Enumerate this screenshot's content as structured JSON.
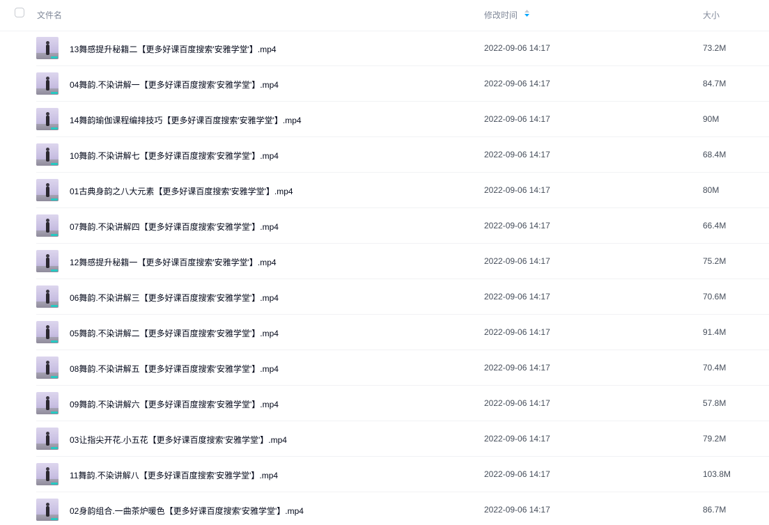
{
  "header": {
    "name_label": "文件名",
    "time_label": "修改时间",
    "size_label": "大小",
    "sort_icon": "sort-arrows-icon"
  },
  "colors": {
    "accent": "#06a7ff",
    "divider": "#f1f2f4",
    "thumb_badge": "#27c9c2"
  },
  "files": [
    {
      "name": "13舞感提升秘籍二【更多好课百度搜索'安雅学堂'】.mp4",
      "time": "2022-09-06 14:17",
      "size": "73.2M"
    },
    {
      "name": "04舞韵.不染讲解一【更多好课百度搜索'安雅学堂'】.mp4",
      "time": "2022-09-06 14:17",
      "size": "84.7M"
    },
    {
      "name": "14舞韵瑜伽课程编排技巧【更多好课百度搜索'安雅学堂'】.mp4",
      "time": "2022-09-06 14:17",
      "size": "90M"
    },
    {
      "name": "10舞韵.不染讲解七【更多好课百度搜索'安雅学堂'】.mp4",
      "time": "2022-09-06 14:17",
      "size": "68.4M"
    },
    {
      "name": "01古典身韵之八大元素【更多好课百度搜索'安雅学堂'】.mp4",
      "time": "2022-09-06 14:17",
      "size": "80M"
    },
    {
      "name": "07舞韵.不染讲解四【更多好课百度搜索'安雅学堂'】.mp4",
      "time": "2022-09-06 14:17",
      "size": "66.4M"
    },
    {
      "name": "12舞感提升秘籍一【更多好课百度搜索'安雅学堂'】.mp4",
      "time": "2022-09-06 14:17",
      "size": "75.2M"
    },
    {
      "name": "06舞韵.不染讲解三【更多好课百度搜索'安雅学堂'】.mp4",
      "time": "2022-09-06 14:17",
      "size": "70.6M"
    },
    {
      "name": "05舞韵.不染讲解二【更多好课百度搜索'安雅学堂'】.mp4",
      "time": "2022-09-06 14:17",
      "size": "91.4M"
    },
    {
      "name": "08舞韵.不染讲解五【更多好课百度搜索'安雅学堂'】.mp4",
      "time": "2022-09-06 14:17",
      "size": "70.4M"
    },
    {
      "name": "09舞韵.不染讲解六【更多好课百度搜索'安雅学堂'】.mp4",
      "time": "2022-09-06 14:17",
      "size": "57.8M"
    },
    {
      "name": "03让指尖开花.小五花【更多好课百度搜索'安雅学堂'】.mp4",
      "time": "2022-09-06 14:17",
      "size": "79.2M"
    },
    {
      "name": "11舞韵.不染讲解八【更多好课百度搜索'安雅学堂'】.mp4",
      "time": "2022-09-06 14:17",
      "size": "103.8M"
    },
    {
      "name": "02身韵组合.一曲茶炉暖色【更多好课百度搜索'安雅学堂'】.mp4",
      "time": "2022-09-06 14:17",
      "size": "86.7M"
    }
  ]
}
